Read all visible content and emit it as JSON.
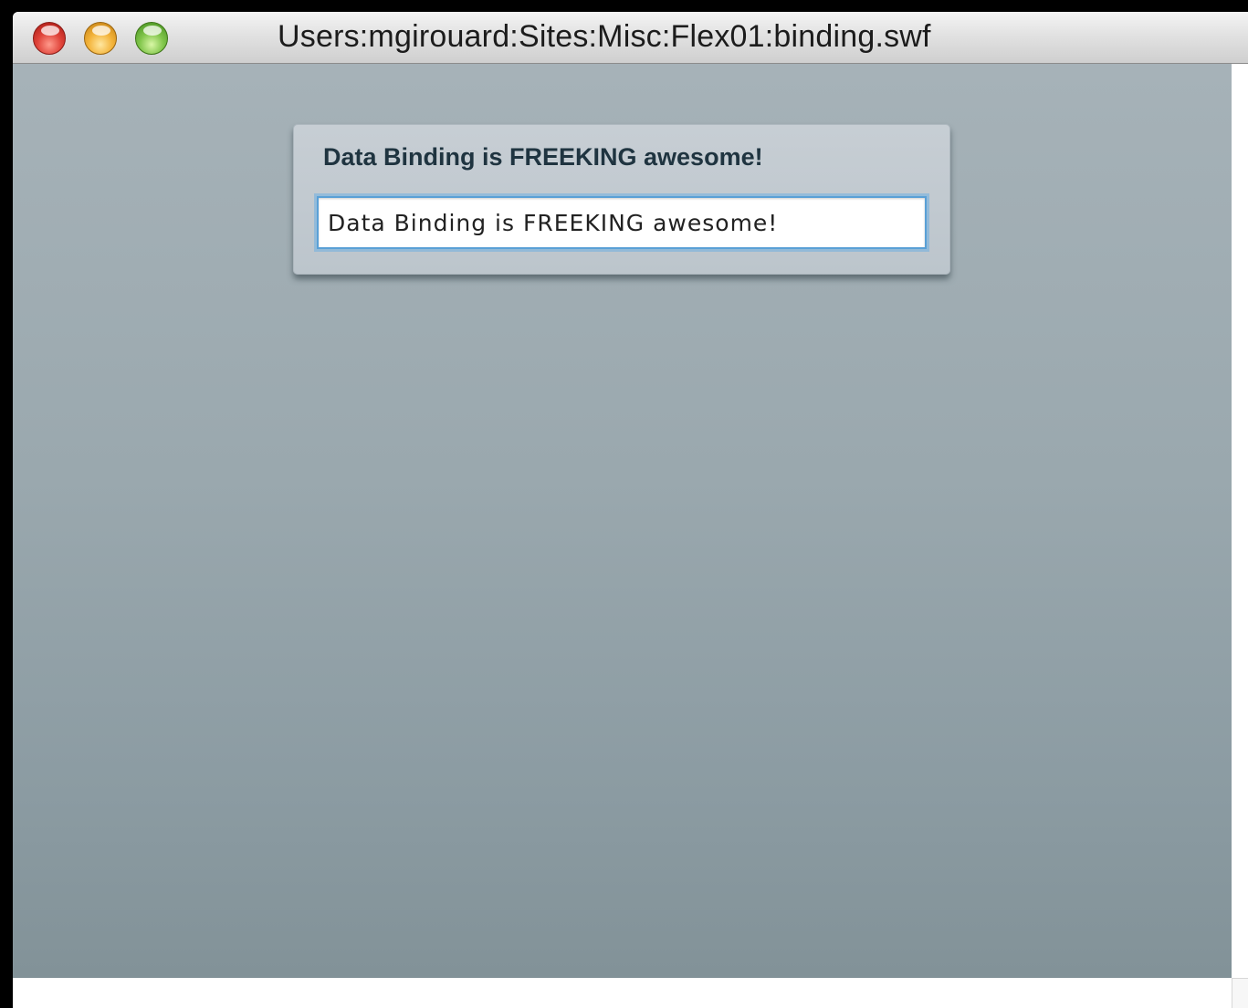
{
  "window": {
    "title": "Users:mgirouard:Sites:Misc:Flex01:binding.swf"
  },
  "panel": {
    "title": "Data Binding is FREEKING awesome!",
    "input_value": "Data Binding is FREEKING awesome!"
  },
  "colors": {
    "stage_top": "#a6b2b8",
    "stage_bottom": "#829298",
    "panel_title": "#1f3440",
    "input_focus": "#5aa0d6"
  }
}
